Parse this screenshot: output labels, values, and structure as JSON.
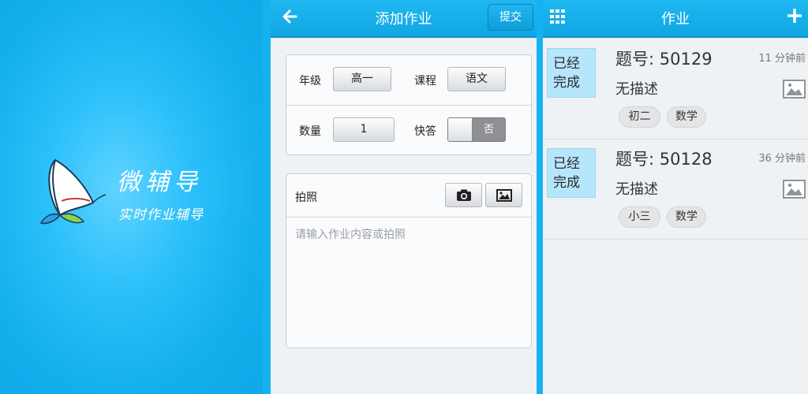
{
  "splash": {
    "brand": "微辅导",
    "slogan": "实时作业辅导",
    "background_color": "#19b4f0"
  },
  "add_homework": {
    "title": "添加作业",
    "back_icon": "arrow-left-icon",
    "submit_label": "提交",
    "grade_label": "年级",
    "grade_value": "高一",
    "course_label": "课程",
    "course_value": "语文",
    "quantity_label": "数量",
    "quantity_value": "1",
    "quick_answer_label": "快答",
    "quick_answer_value": "否",
    "photo_label": "拍照",
    "camera_icon": "camera-icon",
    "gallery_icon": "image-icon",
    "content_placeholder": "请输入作业内容或拍照"
  },
  "homework_list": {
    "title": "作业",
    "menu_icon": "grid-icon",
    "add_icon": "plus-icon",
    "items": [
      {
        "status_line1": "已经",
        "status_line2": "完成",
        "question": "题号: 50129",
        "time": "11 分钟前",
        "description": "无描述",
        "tags": [
          "初二",
          "数学"
        ]
      },
      {
        "status_line1": "已经",
        "status_line2": "完成",
        "question": "题号: 50128",
        "time": "36 分钟前",
        "description": "无描述",
        "tags": [
          "小三",
          "数学"
        ]
      }
    ]
  },
  "colors": {
    "accent": "#19b4f0",
    "status_bg": "#b6e6fb",
    "panel_bg": "#eef2f5"
  }
}
